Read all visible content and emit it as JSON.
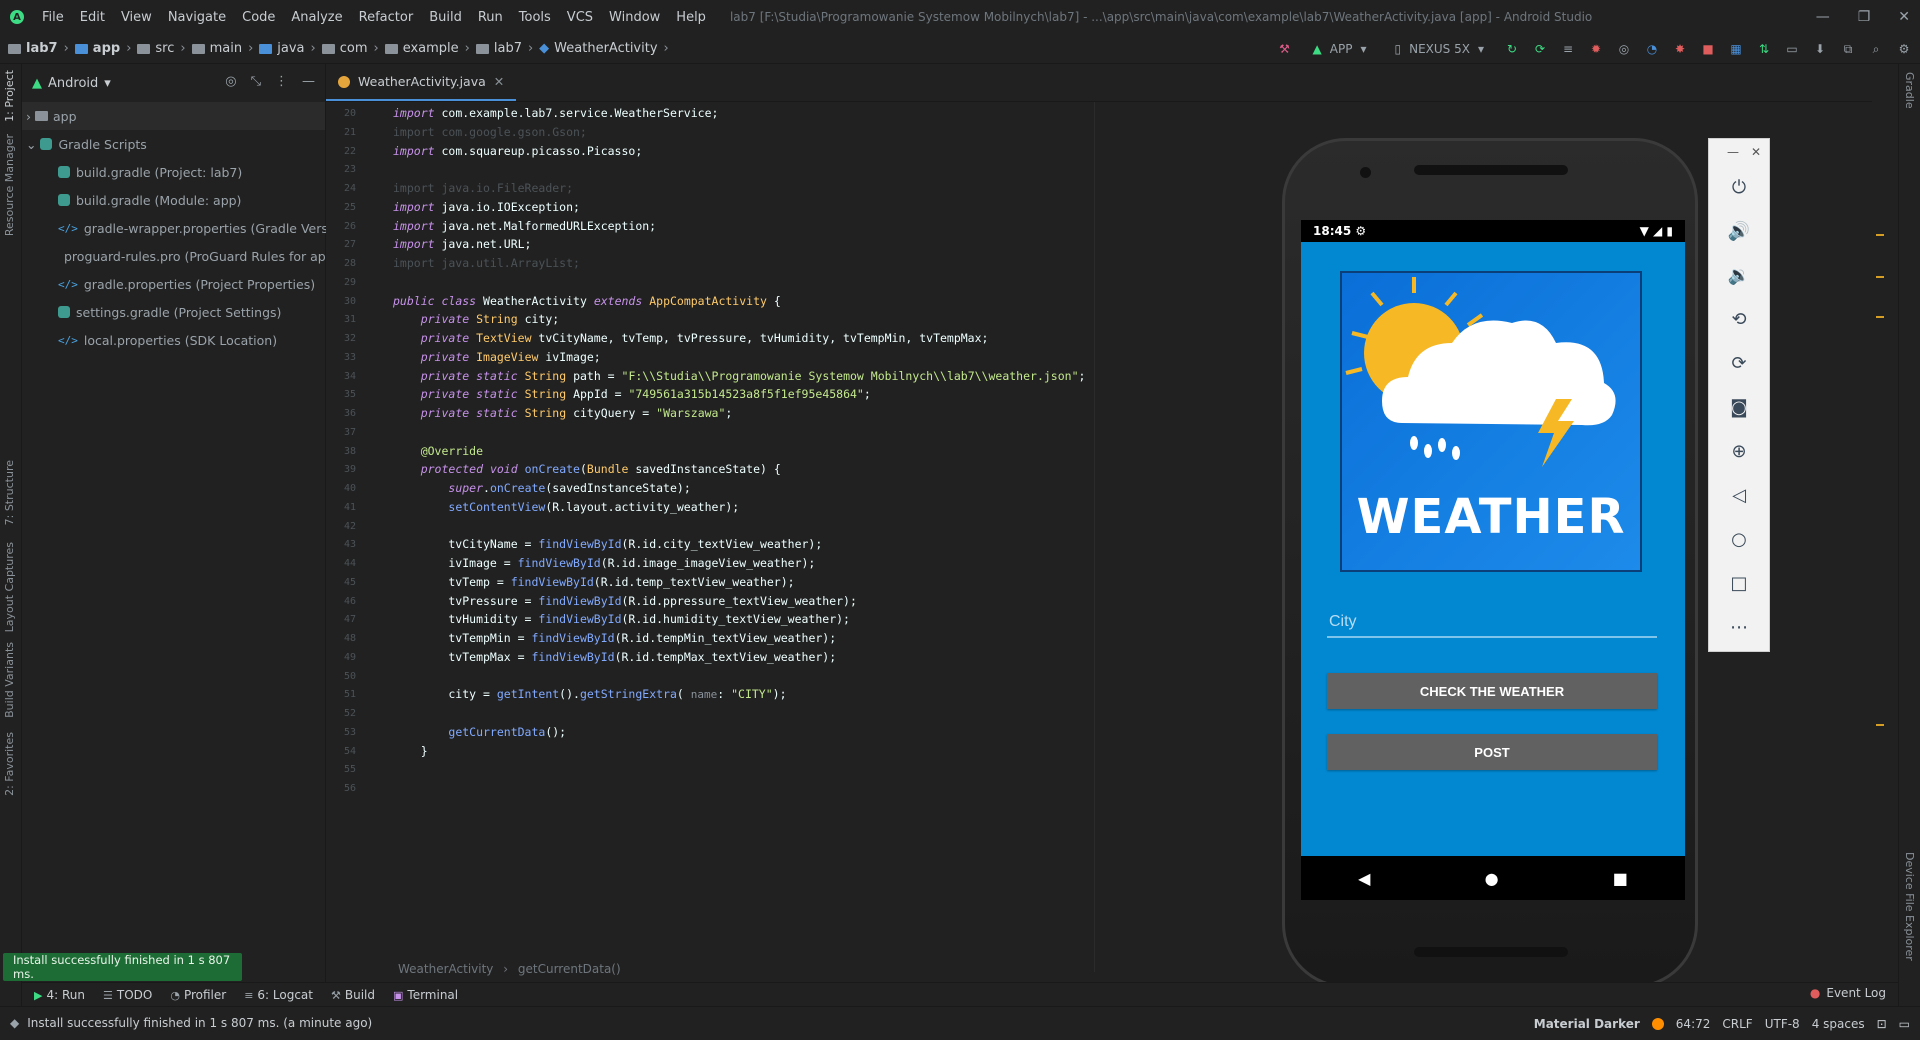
{
  "window": {
    "title": "lab7 [F:\\Studia\\Programowanie Systemow Mobilnych\\lab7] - ...\\app\\src\\main\\java\\com\\example\\lab7\\WeatherActivity.java [app] - Android Studio",
    "menu": [
      "File",
      "Edit",
      "View",
      "Navigate",
      "Code",
      "Analyze",
      "Refactor",
      "Build",
      "Run",
      "Tools",
      "VCS",
      "Window",
      "Help"
    ]
  },
  "breadcrumb": [
    "lab7",
    "app",
    "src",
    "main",
    "java",
    "com",
    "example",
    "lab7",
    "WeatherActivity"
  ],
  "toolbar": {
    "config": "APP",
    "device": "NEXUS 5X"
  },
  "project_panel": {
    "view_mode": "Android",
    "items": [
      {
        "label": "app",
        "kind": "folder"
      },
      {
        "label": "Gradle Scripts",
        "kind": "group"
      },
      {
        "label": "build.gradle (Project: lab7)",
        "kind": "gradle"
      },
      {
        "label": "build.gradle (Module: app)",
        "kind": "gradle"
      },
      {
        "label": "gradle-wrapper.properties (Gradle Version)",
        "kind": "props"
      },
      {
        "label": "proguard-rules.pro (ProGuard Rules for app)",
        "kind": "gradle"
      },
      {
        "label": "gradle.properties (Project Properties)",
        "kind": "props"
      },
      {
        "label": "settings.gradle (Project Settings)",
        "kind": "gradle"
      },
      {
        "label": "local.properties (SDK Location)",
        "kind": "props"
      }
    ]
  },
  "left_tool_tabs": [
    "1: Project",
    "Resource Manager",
    "7: Structure",
    "Layout Captures",
    "Build Variants",
    "2: Favorites"
  ],
  "right_tool_tabs": [
    "Gradle",
    "Device File Explorer"
  ],
  "editor": {
    "tab": "WeatherActivity.java",
    "line_numbers": [
      "20",
      "21",
      "22",
      "23",
      "24",
      "25",
      "26",
      "27",
      "28",
      "29",
      "30",
      "31",
      "32",
      "33",
      "34",
      "35",
      "36",
      "37",
      "38",
      "39",
      "40",
      "41",
      "42",
      "43",
      "44",
      "45",
      "46",
      "47",
      "48",
      "49",
      "50",
      "51",
      "52",
      "53",
      "54",
      "55",
      "56"
    ],
    "lines": [
      "import com.example.lab7.service.WeatherService;",
      "import com.google.gson.Gson;",
      "import com.squareup.picasso.Picasso;",
      "",
      "import java.io.FileReader;",
      "import java.io.IOException;",
      "import java.net.MalformedURLException;",
      "import java.net.URL;",
      "import java.util.ArrayList;",
      "",
      "public class WeatherActivity extends AppCompatActivity {",
      "    private String city;",
      "    private TextView tvCityName, tvTemp, tvPressure, tvHumidity, tvTempMin, tvTempMax;",
      "    private ImageView ivImage;",
      "    private static String path = \"F:\\\\Studia\\\\Programowanie Systemow Mobilnych\\\\lab7\\\\weather.json\";",
      "    private static String AppId = \"749561a315b14523a8f5f1ef95e45864\";",
      "    private static String cityQuery = \"Warszawa\";",
      "",
      "    @Override",
      "    protected void onCreate(Bundle savedInstanceState) {",
      "        super.onCreate(savedInstanceState);",
      "        setContentView(R.layout.activity_weather);",
      "",
      "        tvCityName = findViewById(R.id.city_textView_weather);",
      "        ivImage = findViewById(R.id.image_imageView_weather);",
      "        tvTemp = findViewById(R.id.temp_textView_weather);",
      "        tvPressure = findViewById(R.id.ppressure_textView_weather);",
      "        tvHumidity = findViewById(R.id.humidity_textView_weather);",
      "        tvTempMin = findViewById(R.id.tempMin_textView_weather);",
      "        tvTempMax = findViewById(R.id.tempMax_textView_weather);",
      "",
      "        city = getIntent().getStringExtra( name: \"CITY\");",
      "",
      "        getCurrentData();",
      "    }",
      "",
      ""
    ],
    "breadcrumb": [
      "WeatherActivity",
      "getCurrentData()"
    ]
  },
  "emulator": {
    "time": "18:45",
    "hero_text": "WEATHER",
    "city_placeholder": "City",
    "check_button": "CHECK THE WEATHER",
    "post_button": "POST"
  },
  "notification": "Install successfully finished in 1 s 807 ms.",
  "bottom_tabs": [
    "4: Run",
    "TODO",
    "Profiler",
    "6: Logcat",
    "Build",
    "Terminal"
  ],
  "event_log": "Event Log",
  "statusbar": {
    "message": "Install successfully finished in 1 s 807 ms. (a minute ago)",
    "theme": "Material Darker",
    "position": "64:72",
    "line_sep": "CRLF",
    "encoding": "UTF-8",
    "indent": "4 spaces"
  },
  "colors": {
    "accent": "#4a90d9",
    "screen_bg": "#0288d1",
    "button_gray": "#616161",
    "toast_green": "#1e6c35"
  }
}
